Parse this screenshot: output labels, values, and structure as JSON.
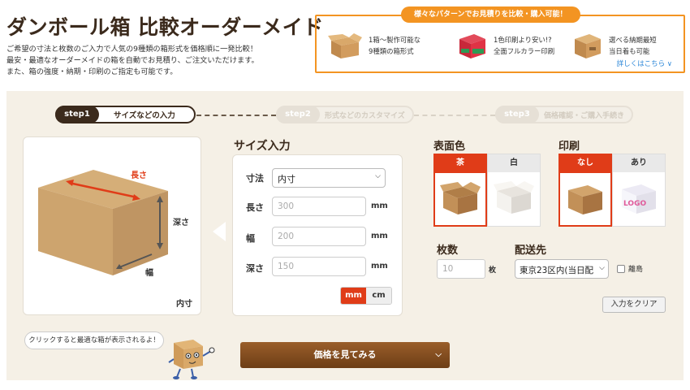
{
  "header": {
    "title": "ダンボール箱 比較オーダーメイド",
    "desc_lines": [
      "ご希望の寸法と枚数のご入力で人気の9種類の箱形式を価格順に一発比較！",
      "最安・最適なオーダーメイドの箱を自動でお見積り、ご注文いただけます。",
      "また、箱の強度・納期・印刷のご指定も可能です。"
    ]
  },
  "promo": {
    "tag": "様々なパターンでお見積りを比較・購入可能！",
    "features": [
      {
        "line1": "1箱〜製作可能な",
        "line2": "9種類の箱形式",
        "icon": "cardboard-box-icon"
      },
      {
        "line1": "1色印刷より安い!?",
        "line2": "全面フルカラー印刷",
        "icon": "printed-box-icon"
      },
      {
        "line1": "選べる納期最短",
        "line2": "当日着も可能",
        "icon": "delivery-box-icon"
      }
    ],
    "link": "詳しくはこちら ∨"
  },
  "steps": [
    {
      "badge": "step1",
      "label": "サイズなどの入力"
    },
    {
      "badge": "step2",
      "label": "形式などのカスタマイズ"
    },
    {
      "badge": "step3",
      "label": "価格確認・ご購入手続き"
    }
  ],
  "diagram": {
    "length": "長さ",
    "depth": "深さ",
    "width": "幅",
    "inner": "内寸"
  },
  "size_input": {
    "heading": "サイズ入力",
    "dimension_label": "寸法",
    "dimension_value": "内寸",
    "length_label": "長さ",
    "length_placeholder": "300",
    "width_label": "幅",
    "width_placeholder": "200",
    "depth_label": "深さ",
    "depth_placeholder": "150",
    "unit": "mm",
    "unit_mm": "mm",
    "unit_cm": "cm",
    "active_unit": "mm"
  },
  "surface_color": {
    "heading": "表面色",
    "options": [
      {
        "label": "茶",
        "selected": true
      },
      {
        "label": "白",
        "selected": false
      }
    ]
  },
  "print": {
    "heading": "印刷",
    "options": [
      {
        "label": "なし",
        "selected": true
      },
      {
        "label": "あり",
        "selected": false
      }
    ],
    "logo_text": "LOGO"
  },
  "quantity": {
    "heading": "枚数",
    "placeholder": "10",
    "unit": "枚"
  },
  "shipping": {
    "heading": "配送先",
    "value": "東京23区内(当日配",
    "island_label": "離島"
  },
  "clear_button": "入力をクリア",
  "hint": "クリックすると最適な箱が表示されるよ！",
  "cta": "価格を見てみる",
  "colors": {
    "accent": "#f39422",
    "brown": "#3b2a1c",
    "red": "#e03c18",
    "panel": "#f5f0e6"
  }
}
